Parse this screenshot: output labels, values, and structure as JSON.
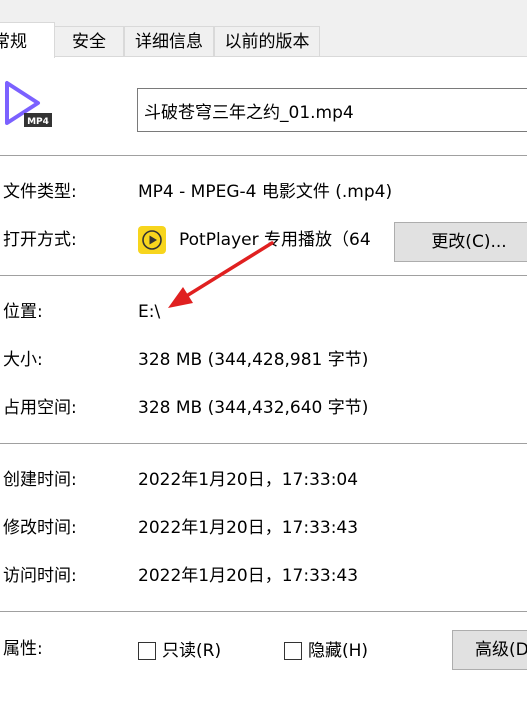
{
  "tabs": {
    "general": "常规",
    "security": "安全",
    "details": "详细信息",
    "previous_versions": "以前的版本"
  },
  "file": {
    "icon_badge": "MP4",
    "name": "斗破苍穹三年之约_01.mp4"
  },
  "properties": {
    "type_label": "文件类型:",
    "type_value": "MP4 - MPEG-4 电影文件 (.mp4)",
    "opens_with_label": "打开方式:",
    "opens_with_value": "PotPlayer 专用播放（64",
    "change_button": "更改(C)...",
    "location_label": "位置:",
    "location_value": "E:\\",
    "size_label": "大小:",
    "size_value": "328 MB (344,428,981 字节)",
    "size_on_disk_label": "占用空间:",
    "size_on_disk_value": "328 MB (344,432,640 字节)",
    "created_label": "创建时间:",
    "created_value": "2022年1月20日，17:33:04",
    "modified_label": "修改时间:",
    "modified_value": "2022年1月20日，17:33:43",
    "accessed_label": "访问时间:",
    "accessed_value": "2022年1月20日，17:33:43",
    "attributes_label": "属性:",
    "readonly_label": "只读(R)",
    "hidden_label": "隐藏(H)",
    "advanced_button": "高级(D)..."
  },
  "colors": {
    "accent_purple": "#7b61ff",
    "potplayer_yellow": "#f7d51d",
    "annotation_red": "#e02020"
  }
}
